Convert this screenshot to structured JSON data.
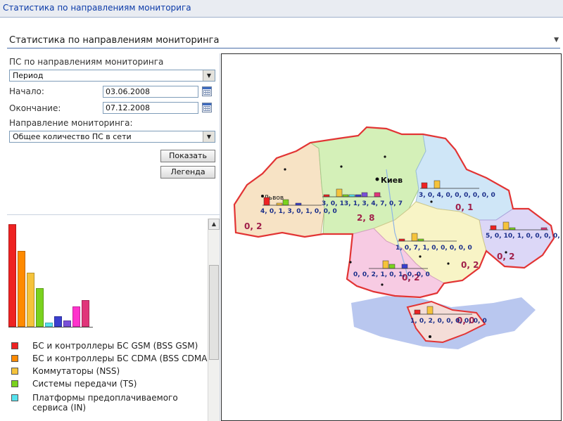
{
  "top_bar": {
    "title": "Статистика  по  направлениям  мониторига"
  },
  "panel": {
    "title": "Статистика по направлениям мониторинга"
  },
  "filters": {
    "group_label": "ПС по направлениям мониторинга",
    "period_select": "Период",
    "start_label": "Начало:",
    "start_value": "03.06.2008",
    "end_label": "Окончание:",
    "end_value": "07.12.2008",
    "direction_label": "Направление мониторинга:",
    "direction_select": "Общее количество ПС в сети",
    "show_button": "Показать",
    "legend_button": "Легенда"
  },
  "legend": {
    "items": [
      {
        "label": "БС и контроллеры БС GSM (BSS GSM)",
        "color": "#ee2222"
      },
      {
        "label": "БС и контроллеры БС CDMA (BSS CDMA)",
        "color": "#ff8a00"
      },
      {
        "label": "Коммутаторы (NSS)",
        "color": "#f5c33b"
      },
      {
        "label": "Системы передачи (TS)",
        "color": "#7ad21e"
      },
      {
        "label": "Платформы предоплачиваемого сервиса (IN)",
        "color": "#55e2ee"
      }
    ]
  },
  "legend_chart": {
    "colors": [
      "#ee2222",
      "#ff8a00",
      "#f5c33b",
      "#7ad21e",
      "#55e2ee",
      "#3b3fcf",
      "#7a50d8",
      "#ff33cc",
      "#e0357a"
    ],
    "levels": [
      1.0,
      0.74,
      0.53,
      0.38,
      0.04,
      0.1,
      0.06,
      0.2,
      0.26
    ]
  },
  "map": {
    "cities": {
      "kiev": "Киев",
      "lviv": "Львов"
    },
    "region_labels": {
      "west": "0, 2",
      "center": "2, 8",
      "north_east": "0, 1",
      "east": "0, 2",
      "center_south": "0, 2",
      "south": "0, 2",
      "crimea": "0, 0"
    },
    "bar_labels": {
      "lviv": "4, 0, 1, 3, 0, 1, 0, 0, 0",
      "kiev": "3, 0, 13, 1, 3, 4, 7, 0, 7",
      "kharkiv": "3, 0, 4, 0, 0, 0, 0, 0, 0",
      "donetsk": "5, 0, 10, 1, 0, 0, 0, 0, 1",
      "dnipro": "1, 0, 7, 1, 0, 0, 0, 0, 0",
      "odesa": "0, 0, 2, 1, 0, 1, 0, 0, 0",
      "crimea": "1, 0, 2, 0, 0, 0, 0, 0, 0"
    }
  }
}
